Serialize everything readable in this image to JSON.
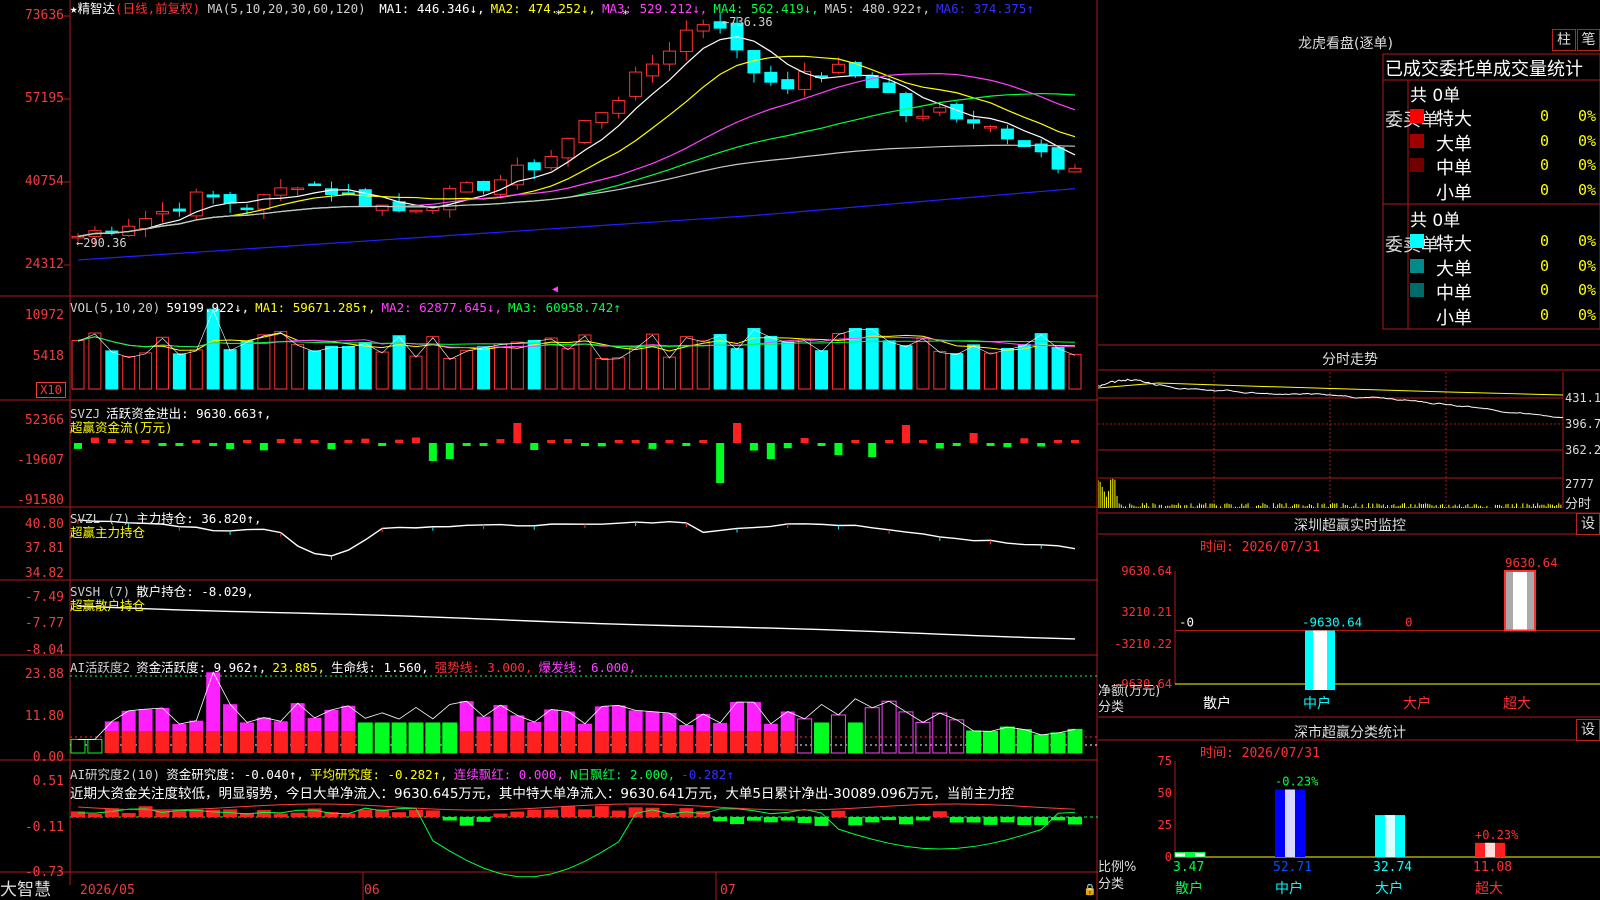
{
  "main": {
    "header": {
      "star": "★",
      "name": "精智达",
      "period": "(日线,前复权)",
      "ma_label": "MA(5,10,20,30,60,120)",
      "ma": [
        {
          "label": "MA1:",
          "value": "446.346",
          "arrow": "↓",
          "color": "#ffffff"
        },
        {
          "label": "MA2:",
          "value": "474.252",
          "arrow": "↓",
          "color": "#ffff00"
        },
        {
          "label": "MA3:",
          "value": "529.212",
          "arrow": "↓",
          "color": "#ff40ff"
        },
        {
          "label": "MA4:",
          "value": "562.419",
          "arrow": "↓",
          "color": "#00ff40"
        },
        {
          "label": "MA5:",
          "value": "480.922",
          "arrow": "↑",
          "color": "#d0d0d0"
        },
        {
          "label": "MA6:",
          "value": "374.375",
          "arrow": "↑",
          "color": "#3030ff"
        }
      ]
    },
    "y_labels": [
      "73636",
      "57195",
      "40754",
      "24312"
    ],
    "annotations": {
      "high": "736.36",
      "low": "290.36"
    }
  },
  "vol": {
    "header": [
      {
        "text": "VOL(5,10,20)",
        "color": "#d0d0d0"
      },
      {
        "text": "59199.922↓,",
        "color": "#ffffff"
      },
      {
        "text": "MA1: 59671.285↑,",
        "color": "#ffff00"
      },
      {
        "text": "MA2: 62877.645↓,",
        "color": "#ff40ff"
      },
      {
        "text": "MA3: 60958.742↑",
        "color": "#00ff40"
      }
    ],
    "y_labels": [
      "10972",
      "5418"
    ],
    "unit": "X10"
  },
  "svzj": {
    "header": [
      {
        "text": "SVZJ",
        "color": "#d0d0d0"
      },
      {
        "text": "活跃资金进出: 9630.663↑,",
        "color": "#ffffff"
      }
    ],
    "subtitle": "超赢资金流(万元)",
    "y_labels": [
      "52366",
      "-19607",
      "-91580"
    ]
  },
  "svzl": {
    "header": [
      {
        "text": "SVZL (7)",
        "color": "#d0d0d0"
      },
      {
        "text": "主力持仓: 36.820↑,",
        "color": "#ffffff"
      }
    ],
    "subtitle": "超赢主力持仓",
    "y_labels": [
      "40.80",
      "37.81",
      "34.82"
    ]
  },
  "svsh": {
    "header": [
      {
        "text": "SVSH (7)",
        "color": "#d0d0d0"
      },
      {
        "text": "散户持仓: -8.029,",
        "color": "#ffffff"
      }
    ],
    "subtitle": "超赢散户持仓",
    "y_labels": [
      "-7.49",
      "-7.77",
      "-8.04"
    ]
  },
  "ai_active": {
    "header": [
      {
        "text": "AI活跃度2",
        "color": "#d0d0d0"
      },
      {
        "text": "资金活跃度: 9.962↑,",
        "color": "#ffffff"
      },
      {
        "text": "23.885,",
        "color": "#ffff00"
      },
      {
        "text": "生命线: 1.560,",
        "color": "#ffffff"
      },
      {
        "text": "强势线: 3.000,",
        "color": "#ff3030"
      },
      {
        "text": "爆发线: 6.000,",
        "color": "#ff40ff"
      }
    ],
    "y_labels": [
      "23.88",
      "11.80",
      "0.00"
    ]
  },
  "ai_research": {
    "header": [
      {
        "text": "AI研究度2(10)",
        "color": "#d0d0d0"
      },
      {
        "text": "资金研究度: -0.040↑,",
        "color": "#ffffff"
      },
      {
        "text": "平均研究度: -0.282↑,",
        "color": "#ffff00"
      },
      {
        "text": "连续飘红: 0.000,",
        "color": "#ff40ff"
      },
      {
        "text": "N日飘红: 2.000,",
        "color": "#00ff40"
      },
      {
        "text": "-0.282↑",
        "color": "#3030ff"
      }
    ],
    "comment": "近期大资金关注度较低，明显弱势，今日大单净流入：9630.645万元，其中特大单净流入：9630.641万元，大单5日累计净出-30089.096万元，当前主力控",
    "y_labels": [
      "0.51",
      "-0.11",
      "-0.73"
    ]
  },
  "bottom_bar": {
    "brand": "大智慧",
    "dates": [
      "2026/05",
      "06",
      "07"
    ]
  },
  "right": {
    "lhb": {
      "title": "龙虎看盘(逐单)",
      "buttons": [
        "柱",
        "笔"
      ],
      "stats_title": "已成交委托单成交量统计",
      "buy": {
        "side_label": "委买单",
        "total": "共 0单",
        "rows": [
          {
            "name": "特大",
            "count": "0",
            "pct": "0%",
            "color": "#ff0000"
          },
          {
            "name": "大单",
            "count": "0",
            "pct": "0%",
            "color": "#a00000"
          },
          {
            "name": "中单",
            "count": "0",
            "pct": "0%",
            "color": "#700000"
          },
          {
            "name": "小单",
            "count": "0",
            "pct": "0%",
            "color": "#000000"
          }
        ]
      },
      "sell": {
        "side_label": "委卖单",
        "total": "共 0单",
        "rows": [
          {
            "name": "特大",
            "count": "0",
            "pct": "0%",
            "color": "#00ffff"
          },
          {
            "name": "大单",
            "count": "0",
            "pct": "0%",
            "color": "#008a8a"
          },
          {
            "name": "中单",
            "count": "0",
            "pct": "0%",
            "color": "#006a6a"
          },
          {
            "name": "小单",
            "count": "0",
            "pct": "0%",
            "color": "#000000"
          }
        ]
      }
    },
    "intraday": {
      "title": "分时走势",
      "labels": [
        "431.1",
        "396.7",
        "362.2",
        "2777"
      ],
      "unit": "分时"
    },
    "monitor": {
      "title": "深圳超赢实时监控",
      "settings": "设",
      "time": "时间: 2026/07/31",
      "y_labels": [
        "9630.64",
        "3210.21",
        "-3210.22",
        "-9630.64"
      ],
      "y_unit": "净额(万元)",
      "x_unit": "分类",
      "categories": [
        "散户",
        "中户",
        "大户",
        "超大"
      ],
      "values": [
        0,
        -9630.64,
        0,
        9630.64
      ],
      "value_labels": [
        "-0",
        "-9630.64",
        "0",
        "9630.64"
      ]
    },
    "classify": {
      "title": "深市超赢分类统计",
      "settings": "设",
      "time": "时间: 2026/07/31",
      "y_labels": [
        "75",
        "50",
        "25",
        "0"
      ],
      "y_unit": "比例%",
      "x_unit": "分类",
      "categories": [
        "散户",
        "中户",
        "大户",
        "超大"
      ],
      "values": [
        3.47,
        52.71,
        32.74,
        11.08
      ],
      "value_labels": [
        "3.47",
        "52.71",
        "32.74",
        "11.08"
      ],
      "changes": [
        "",
        "-0.23%",
        "",
        "+0.23%"
      ]
    }
  }
}
